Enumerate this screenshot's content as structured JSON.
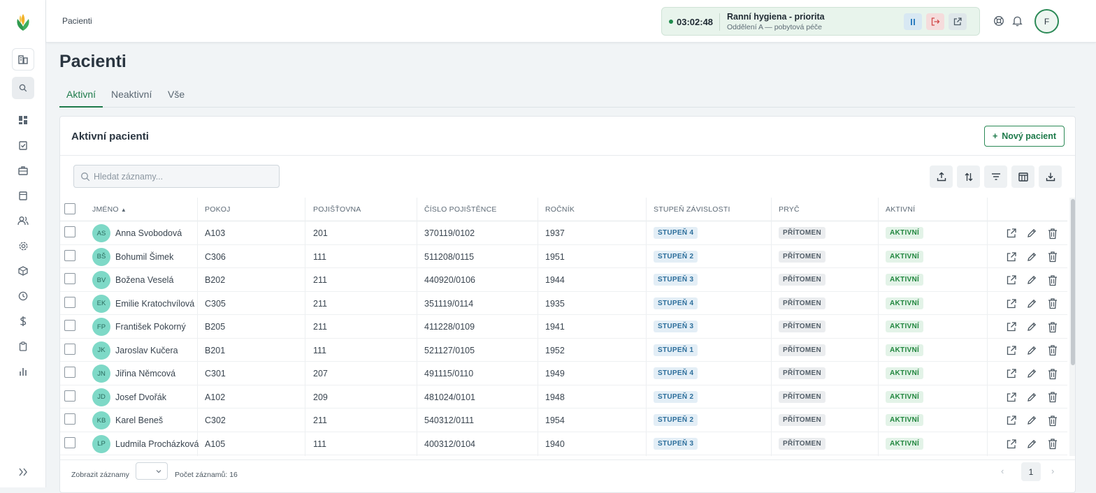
{
  "breadcrumb": "Pacienti",
  "timer": {
    "time": "03:02:48",
    "title": "Ranní hygiena - priorita",
    "subtitle": "Oddělení A — pobytová péče"
  },
  "user": {
    "initial": "F"
  },
  "page_title": "Pacienti",
  "tabs": [
    {
      "label": "Aktivní",
      "active": true
    },
    {
      "label": "Neaktivní",
      "active": false
    },
    {
      "label": "Vše",
      "active": false
    }
  ],
  "card": {
    "title": "Aktivní pacienti",
    "new_button": "Nový pacient"
  },
  "search": {
    "placeholder": "Hledat záznamy..."
  },
  "columns": [
    "Jméno",
    "Pokoj",
    "Pojišťovna",
    "Číslo pojištěnce",
    "Ročník",
    "Stupeň závislosti",
    "Pryč",
    "Aktivní"
  ],
  "rows": [
    {
      "initials": "AS",
      "name": "Anna Svobodová",
      "room": "A103",
      "insurer": "201",
      "insured_no": "370119/0102",
      "year": "1937",
      "level": "STUPEŇ 4",
      "away": "PŘÍTOMEN",
      "active": "AKTIVNÍ"
    },
    {
      "initials": "BŠ",
      "name": "Bohumil Šimek",
      "room": "C306",
      "insurer": "111",
      "insured_no": "511208/0115",
      "year": "1951",
      "level": "STUPEŇ 2",
      "away": "PŘÍTOMEN",
      "active": "AKTIVNÍ"
    },
    {
      "initials": "BV",
      "name": "Božena Veselá",
      "room": "B202",
      "insurer": "211",
      "insured_no": "440920/0106",
      "year": "1944",
      "level": "STUPEŇ 3",
      "away": "PŘÍTOMEN",
      "active": "AKTIVNÍ"
    },
    {
      "initials": "EK",
      "name": "Emilie Kratochvílová",
      "room": "C305",
      "insurer": "211",
      "insured_no": "351119/0114",
      "year": "1935",
      "level": "STUPEŇ 4",
      "away": "PŘÍTOMEN",
      "active": "AKTIVNÍ"
    },
    {
      "initials": "FP",
      "name": "František Pokorný",
      "room": "B205",
      "insurer": "211",
      "insured_no": "411228/0109",
      "year": "1941",
      "level": "STUPEŇ 3",
      "away": "PŘÍTOMEN",
      "active": "AKTIVNÍ"
    },
    {
      "initials": "JK",
      "name": "Jaroslav Kučera",
      "room": "B201",
      "insurer": "111",
      "insured_no": "521127/0105",
      "year": "1952",
      "level": "STUPEŇ 1",
      "away": "PŘÍTOMEN",
      "active": "AKTIVNÍ"
    },
    {
      "initials": "JN",
      "name": "Jiřina Němcová",
      "room": "C301",
      "insurer": "207",
      "insured_no": "491115/0110",
      "year": "1949",
      "level": "STUPEŇ 4",
      "away": "PŘÍTOMEN",
      "active": "AKTIVNÍ"
    },
    {
      "initials": "JD",
      "name": "Josef Dvořák",
      "room": "A102",
      "insurer": "209",
      "insured_no": "481024/0101",
      "year": "1948",
      "level": "STUPEŇ 2",
      "away": "PŘÍTOMEN",
      "active": "AKTIVNÍ"
    },
    {
      "initials": "KB",
      "name": "Karel Beneš",
      "room": "C302",
      "insurer": "211",
      "insured_no": "540312/0111",
      "year": "1954",
      "level": "STUPEŇ 2",
      "away": "PŘÍTOMEN",
      "active": "AKTIVNÍ"
    },
    {
      "initials": "LP",
      "name": "Ludmila Procházková",
      "room": "A105",
      "insurer": "111",
      "insured_no": "400312/0104",
      "year": "1940",
      "level": "STUPEŇ 3",
      "away": "PŘÍTOMEN",
      "active": "AKTIVNÍ"
    }
  ],
  "footer": {
    "show_label": "Zobrazit záznamy",
    "count_label": "Počet záznamů: 16",
    "page": "1"
  },
  "colors": {
    "accent": "#1d7a4a",
    "avatar": "#7ed9c7"
  }
}
